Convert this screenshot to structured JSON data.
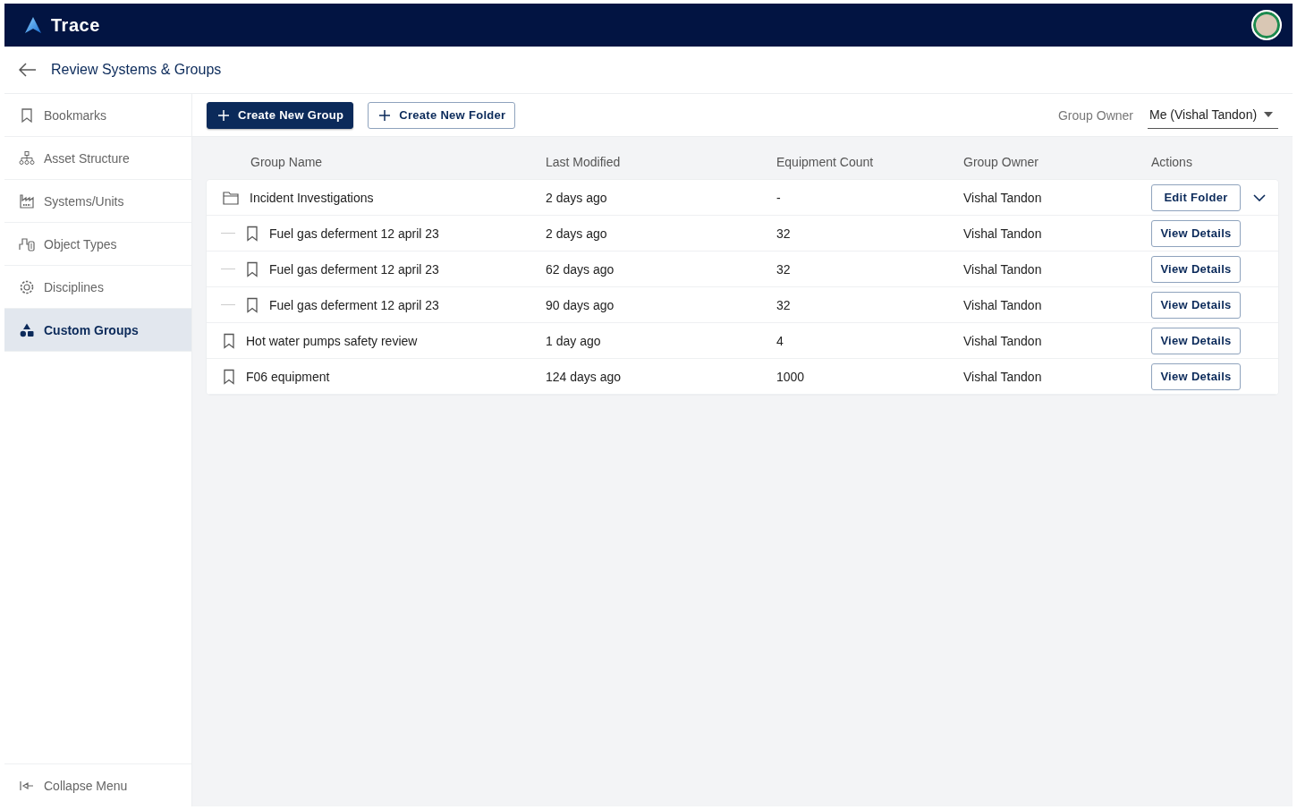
{
  "app": {
    "title": "Trace"
  },
  "page": {
    "title": "Review Systems & Groups"
  },
  "sidebar": {
    "items": [
      {
        "label": "Bookmarks",
        "selected": false
      },
      {
        "label": "Asset Structure",
        "selected": false
      },
      {
        "label": "Systems/Units",
        "selected": false
      },
      {
        "label": "Object Types",
        "selected": false
      },
      {
        "label": "Disciplines",
        "selected": false
      },
      {
        "label": "Custom Groups",
        "selected": true
      }
    ],
    "footer": "Collapse Menu"
  },
  "toolbar": {
    "buttons": [
      {
        "label": "Create New Group",
        "kind": "primary"
      },
      {
        "label": "Create New Folder",
        "kind": "secondary"
      }
    ],
    "filter": {
      "label": "Group Owner",
      "value": "Me (Vishal Tandon)"
    }
  },
  "table": {
    "columns": [
      "Group Name",
      "Last Modified",
      "Equipment Count",
      "Group Owner",
      "Actions"
    ],
    "rows": [
      {
        "kind": "folder",
        "name": "Incident Investigations",
        "last_modified": "2 days ago",
        "equipment_count": "-",
        "owner": "Vishal Tandon",
        "action": "Edit Folder",
        "expanded": true,
        "children": [
          {
            "kind": "group",
            "name": "Fuel gas deferment 12 april 23",
            "last_modified": "2 days ago",
            "equipment_count": "32",
            "owner": "Vishal Tandon",
            "action": "View Details"
          },
          {
            "kind": "group",
            "name": "Fuel gas deferment 12 april 23",
            "last_modified": "62 days ago",
            "equipment_count": "32",
            "owner": "Vishal Tandon",
            "action": "View Details"
          },
          {
            "kind": "group",
            "name": "Fuel gas deferment 12 april 23",
            "last_modified": "90 days ago",
            "equipment_count": "32",
            "owner": "Vishal Tandon",
            "action": "View Details"
          }
        ]
      },
      {
        "kind": "group",
        "name": "Hot water pumps safety review",
        "last_modified": "1 day ago",
        "equipment_count": "4",
        "owner": "Vishal Tandon",
        "action": "View Details"
      },
      {
        "kind": "group",
        "name": "F06 equipment",
        "last_modified": "124 days ago",
        "equipment_count": "1000",
        "owner": "Vishal Tandon",
        "action": "View Details"
      }
    ]
  }
}
